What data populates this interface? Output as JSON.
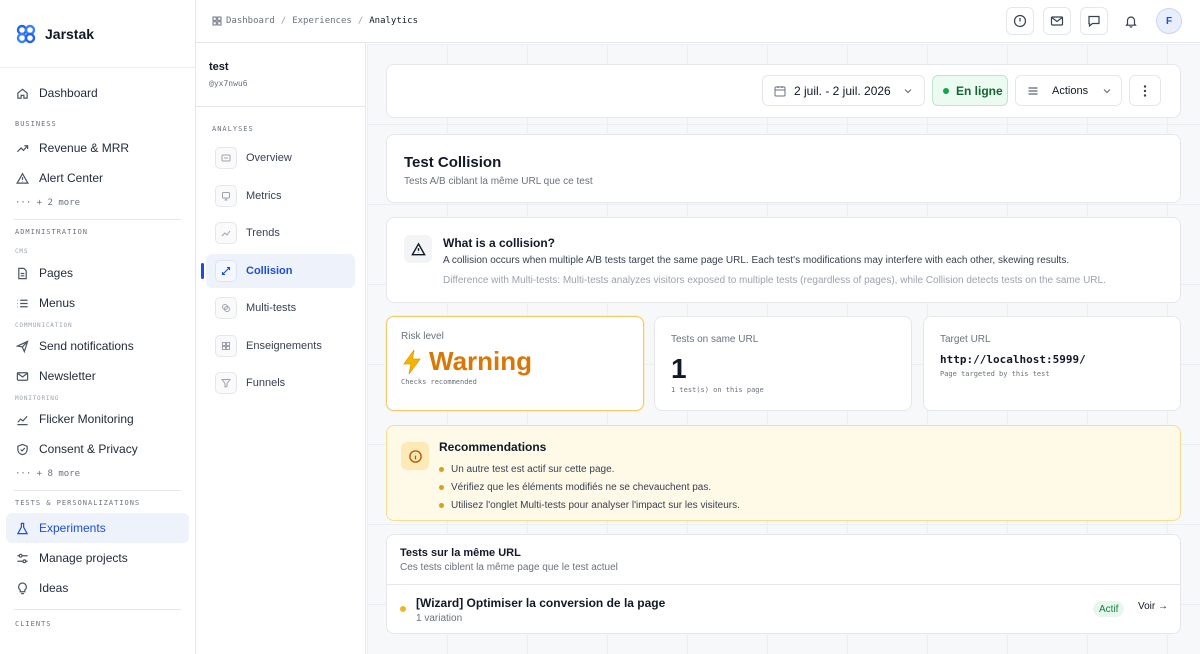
{
  "brand": {
    "name": "Jarstak"
  },
  "sidebar": {
    "dashboard": "Dashboard",
    "business": {
      "heading": "BUSINESS",
      "revenue": "Revenue & MRR",
      "alerts": "Alert Center",
      "more": "··· + 2 more"
    },
    "administration": {
      "heading": "ADMINISTRATION",
      "cms": "CMS",
      "pages": "Pages",
      "menus": "Menus",
      "communication": "COMMUNICATION",
      "notifications": "Send notifications",
      "newsletter": "Newsletter",
      "monitoring": "MONITORING",
      "flicker": "Flicker Monitoring",
      "consent": "Consent & Privacy",
      "more": "··· + 8 more"
    },
    "tests": {
      "heading": "TESTS & PERSONALIZATIONS",
      "experiments": "Experiments",
      "projects": "Manage projects",
      "ideas": "Ideas"
    },
    "clients": {
      "heading": "CLIENTS"
    }
  },
  "breadcrumb": {
    "root": "Dashboard",
    "section": "Experiences",
    "current": "Analytics",
    "sep": "/"
  },
  "topbar": {
    "avatar_initial": "F"
  },
  "panel": {
    "test_name": "test",
    "test_id": "@yx7nwu6",
    "section": "ANALYSES",
    "items": [
      "Overview",
      "Metrics",
      "Trends",
      "Collision",
      "Multi-tests",
      "Enseignements",
      "Funnels"
    ]
  },
  "toolbar": {
    "date_range": "2 juil. - 2 juil. 2026",
    "status": "En ligne",
    "actions": "Actions"
  },
  "header": {
    "title": "Test Collision",
    "subtitle": "Tests A/B ciblant la même URL que ce test"
  },
  "info": {
    "title": "What is a collision?",
    "line1": "A collision occurs when multiple A/B tests target the same page URL. Each test's modifications may interfere with each other, skewing results.",
    "line2": "Difference with Multi-tests: Multi-tests analyzes visitors exposed to multiple tests (regardless of pages), while Collision detects tests on the same URL."
  },
  "stats": {
    "risk": {
      "label": "Risk level",
      "value": "Warning",
      "note": "Checks recommended"
    },
    "tests": {
      "label": "Tests on same URL",
      "value": "1",
      "note": "1 test(s) on this page"
    },
    "url": {
      "label": "Target URL",
      "value": "http://localhost:5999/",
      "note": "Page targeted by this test"
    }
  },
  "recommendations": {
    "title": "Recommendations",
    "items": [
      "Un autre test est actif sur cette page.",
      "Vérifiez que les éléments modifiés ne se chevauchent pas.",
      "Utilisez l'onglet Multi-tests pour analyser l'impact sur les visiteurs."
    ]
  },
  "same_url": {
    "title": "Tests sur la même URL",
    "subtitle": "Ces tests ciblent la même page que le test actuel",
    "rows": [
      {
        "name": "[Wizard] Optimiser la conversion de la page",
        "variations": "1 variation",
        "status": "Actif",
        "action": "Voir →"
      }
    ]
  },
  "colors": {
    "accent": "#1d4ed8",
    "warning": "#d97706",
    "success": "#16a34a"
  }
}
